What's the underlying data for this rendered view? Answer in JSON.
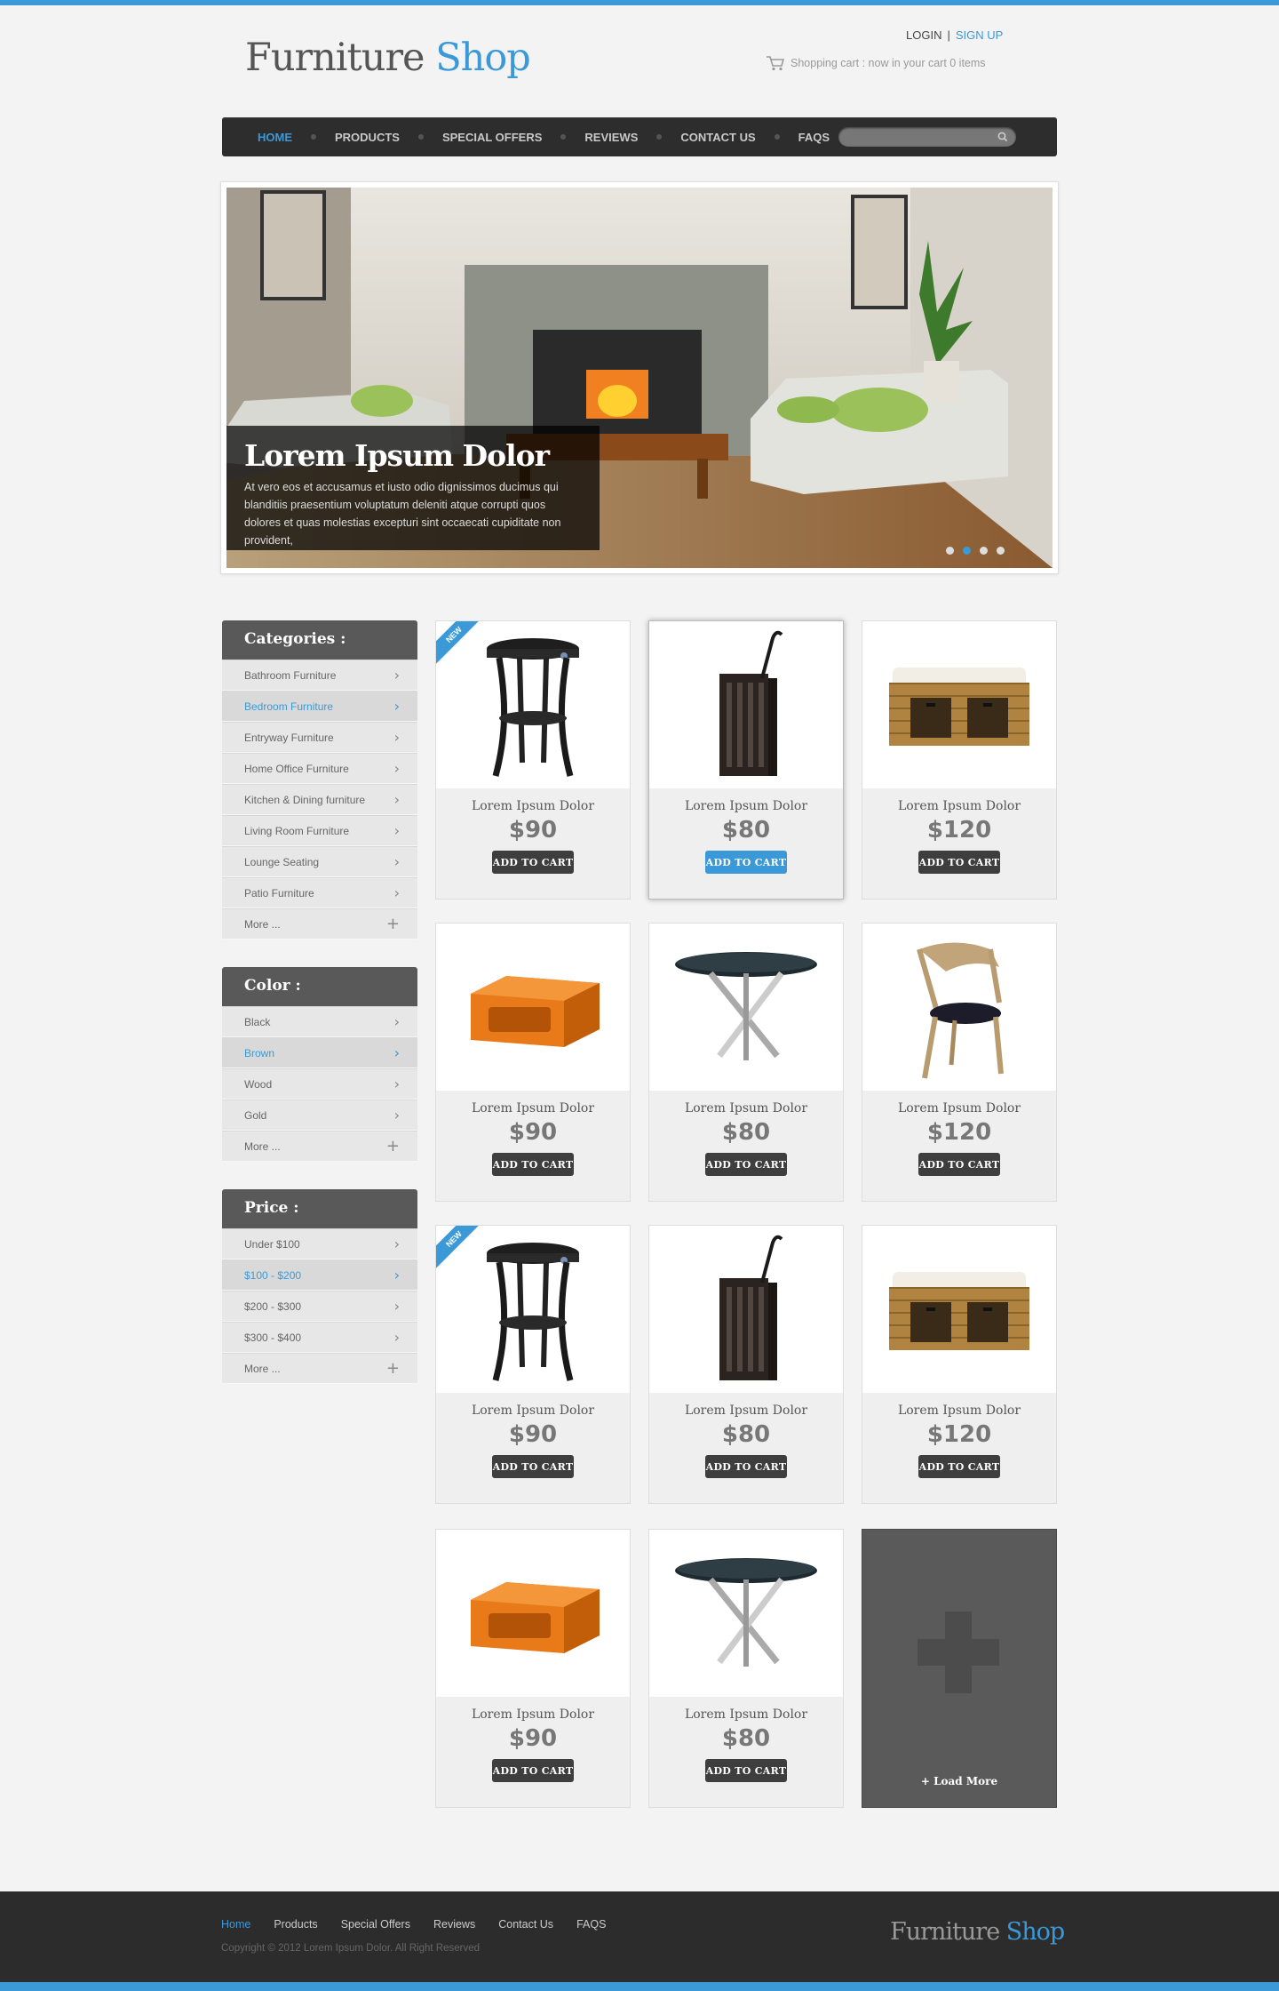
{
  "brand": {
    "part1": "Furniture",
    "part2": "Shop"
  },
  "auth": {
    "login": "LOGIN",
    "separator": "|",
    "signup": "SIGN UP"
  },
  "cart": {
    "text": "Shopping cart : now in your cart 0 items",
    "icon": "cart-icon"
  },
  "nav": {
    "items": [
      "HOME",
      "PRODUCTS",
      "SPECIAL OFFERS",
      "REVIEWS",
      "CONTACT US",
      "FAQS"
    ],
    "active": "HOME",
    "search_placeholder": ""
  },
  "hero": {
    "title": "Lorem Ipsum Dolor",
    "text": "At vero eos et accusamus et iusto odio dignissimos ducimus qui blanditiis praesentium voluptatum deleniti atque corrupti quos dolores et quas molestias excepturi sint occaecati cupiditate non provident,",
    "slides_count": 4,
    "active_slide": 2
  },
  "sidebar": {
    "categories": {
      "title": "Categories :",
      "items": [
        "Bathroom Furniture",
        "Bedroom Furniture",
        "Entryway Furniture",
        "Home Office Furniture",
        "Kitchen & Dining furniture",
        "Living Room Furniture",
        "Lounge Seating",
        "Patio Furniture",
        "More ..."
      ],
      "selected": "Bedroom Furniture"
    },
    "color": {
      "title": "Color :",
      "items": [
        "Black",
        "Brown",
        "Wood",
        "Gold",
        "More ..."
      ],
      "selected": "Brown"
    },
    "price": {
      "title": "Price :",
      "items": [
        "Under $100",
        "$100 - $200",
        "$200 - $300",
        "$300 - $400",
        "More ..."
      ],
      "selected": "$100 - $200"
    }
  },
  "products": [
    {
      "name": "Lorem Ipsum Dolor",
      "price": "$90",
      "button": "ADD TO CART",
      "image": "side-table",
      "badge": "NEW"
    },
    {
      "name": "Lorem Ipsum Dolor",
      "price": "$80",
      "button": "ADD TO CART",
      "image": "umbrella-stand",
      "highlighted": true
    },
    {
      "name": "Lorem Ipsum Dolor",
      "price": "$120",
      "button": "ADD TO CART",
      "image": "wicker-bench"
    },
    {
      "name": "Lorem Ipsum Dolor",
      "price": "$90",
      "button": "ADD TO CART",
      "image": "orange-cube"
    },
    {
      "name": "Lorem Ipsum Dolor",
      "price": "$80",
      "button": "ADD TO CART",
      "image": "round-table"
    },
    {
      "name": "Lorem Ipsum Dolor",
      "price": "$120",
      "button": "ADD TO CART",
      "image": "wood-chair"
    },
    {
      "name": "Lorem Ipsum Dolor",
      "price": "$90",
      "button": "ADD TO CART",
      "image": "side-table",
      "badge": "NEW"
    },
    {
      "name": "Lorem Ipsum Dolor",
      "price": "$80",
      "button": "ADD TO CART",
      "image": "umbrella-stand"
    },
    {
      "name": "Lorem Ipsum Dolor",
      "price": "$120",
      "button": "ADD TO CART",
      "image": "wicker-bench"
    },
    {
      "name": "Lorem Ipsum Dolor",
      "price": "$90",
      "button": "ADD TO CART",
      "image": "orange-cube"
    },
    {
      "name": "Lorem Ipsum Dolor",
      "price": "$80",
      "button": "ADD TO CART",
      "image": "round-table"
    }
  ],
  "load_more": {
    "label": "+ Load More"
  },
  "footer": {
    "links": [
      "Home",
      "Products",
      "Special Offers",
      "Reviews",
      "Contact Us",
      "FAQS"
    ],
    "active": "Home",
    "copyright": "Copyright © 2012 Lorem Ipsum Dolor.  All Right Reserved"
  },
  "colors": {
    "accent": "#3b99d8",
    "dark": "#2d2d2d",
    "sidebar_head": "#595959"
  }
}
